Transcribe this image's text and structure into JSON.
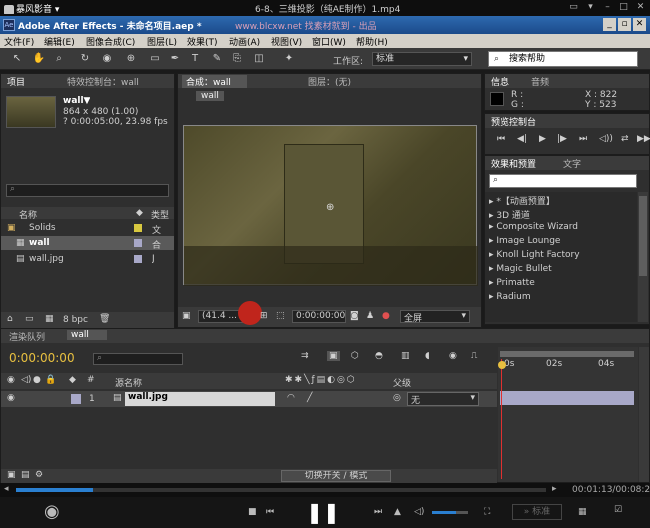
{
  "player": {
    "logo": "暴风影音",
    "title": "6-8、三维投影（纯AE制作）1.mp4",
    "time": "00:01:13/00:08:24",
    "progress": 0.145,
    "enhance_label": "标准"
  },
  "ae": {
    "title": "Adobe After Effects - 未命名项目.aep *",
    "watermark": "www.blcxw.net 找素材就到 - 出品"
  },
  "menu": [
    "文件(F)",
    "编辑(E)",
    "图像合成(C)",
    "图层(L)",
    "效果(T)",
    "动画(A)",
    "视图(V)",
    "窗口(W)",
    "帮助(H)"
  ],
  "toolbar": {
    "workspace_label": "工作区:",
    "workspace_value": "标准",
    "search_placeholder": "搜索帮助"
  },
  "project": {
    "tab_project": "项目",
    "tab_effects": "特效控制台：wall",
    "item_name": "wall▼",
    "item_dims": "864 x 480 (1.00)",
    "item_dur": "? 0:00:05:00, 23.98 fps",
    "col_name": "名称",
    "col_type": "类型",
    "items": [
      {
        "name": "Solids",
        "type": "文",
        "icon": "folder-icon",
        "color": "#d8c840"
      },
      {
        "name": "wall",
        "type": "合",
        "icon": "composition-icon",
        "color": "#a8a8c8"
      },
      {
        "name": "wall.jpg",
        "type": "J",
        "icon": "file-icon",
        "color": "#a8a8c8"
      }
    ],
    "bpc": "8 bpc"
  },
  "comp": {
    "tab_comp": "合成：wall",
    "tab_layer": "图层：(无)",
    "breadcrumb": "wall",
    "zoom": "(41.4 ...",
    "timecode": "0:00:00:00",
    "resolution": "全屏"
  },
  "info": {
    "tab_info": "信息",
    "tab_audio": "音频",
    "r_label": "R :",
    "g_label": "G :",
    "x_label": "X : 822",
    "y_label": "Y : 523"
  },
  "preview": {
    "tab": "预览控制台"
  },
  "effects": {
    "tab_effects": "效果和预置",
    "tab_text": "文字",
    "items": [
      "*【动画预置】",
      "3D 通道",
      "Composite Wizard",
      "Image Lounge",
      "Knoll Light Factory",
      "Magic Bullet",
      "Primatte",
      "Radium"
    ]
  },
  "timeline": {
    "tab_render": "渲染队列",
    "tab_wall": "wall",
    "timecode": "0:00:00:00",
    "col_source": "源名称",
    "col_parent": "父级",
    "layer_index": "1",
    "layer_name": "wall.jpg",
    "parent_value": "无",
    "ruler": [
      "0s",
      "02s",
      "04s"
    ],
    "switch_label": "切换开关 / 模式"
  }
}
